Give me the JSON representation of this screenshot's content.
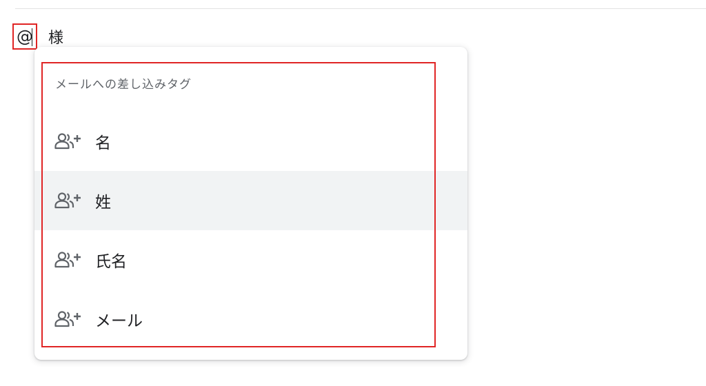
{
  "editor": {
    "trigger_char": "@",
    "honorific": "様"
  },
  "dropdown": {
    "heading": "メールへの差し込みタグ",
    "items": [
      {
        "label": "名",
        "icon": "person-add-icon",
        "highlighted": false
      },
      {
        "label": "姓",
        "icon": "person-add-icon",
        "highlighted": true
      },
      {
        "label": "氏名",
        "icon": "person-add-icon",
        "highlighted": false
      },
      {
        "label": "メール",
        "icon": "person-add-icon",
        "highlighted": false
      }
    ]
  },
  "colors": {
    "annotation_red": "#e02424",
    "hover_background": "#f1f3f4",
    "icon_gray": "#5f6368"
  }
}
